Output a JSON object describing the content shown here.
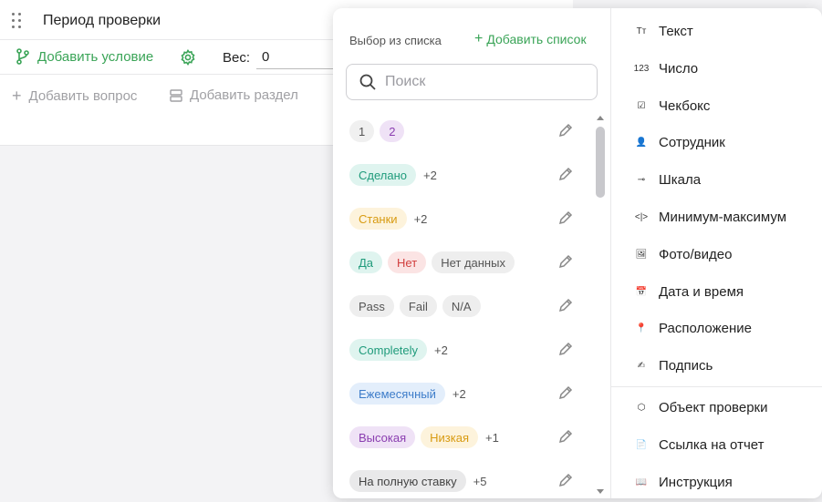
{
  "question": {
    "title": "Период проверки",
    "add_condition": "Добавить условие",
    "weight_label": "Вес:",
    "weight_value": "0",
    "add_question": "Добавить вопрос",
    "add_section": "Добавить раздел"
  },
  "dropdown": {
    "list_header": "Выбор из списка",
    "add_list": "Добавить список",
    "search_placeholder": "Поиск",
    "lists": [
      {
        "chips": [
          {
            "label": "1",
            "color": "#f0f0f0",
            "text": "#555"
          },
          {
            "label": "2",
            "color": "#efe2f6",
            "text": "#8a3db0"
          }
        ],
        "more": ""
      },
      {
        "chips": [
          {
            "label": "Сделано",
            "color": "#dff4ef",
            "text": "#1f9b7b"
          }
        ],
        "more": "+2"
      },
      {
        "chips": [
          {
            "label": "Станки",
            "color": "#fdf3dc",
            "text": "#d89b12"
          }
        ],
        "more": "+2"
      },
      {
        "chips": [
          {
            "label": "Да",
            "color": "#dff4ef",
            "text": "#1f9b7b"
          },
          {
            "label": "Нет",
            "color": "#fbe4e4",
            "text": "#d2403f"
          },
          {
            "label": "Нет данных",
            "color": "#eeeeee",
            "text": "#555"
          }
        ],
        "more": ""
      },
      {
        "chips": [
          {
            "label": "Pass",
            "color": "#eeeeee",
            "text": "#555"
          },
          {
            "label": "Fail",
            "color": "#eeeeee",
            "text": "#555"
          },
          {
            "label": "N/A",
            "color": "#eeeeee",
            "text": "#555"
          }
        ],
        "more": ""
      },
      {
        "chips": [
          {
            "label": "Completely",
            "color": "#dff4ef",
            "text": "#1f9b7b"
          }
        ],
        "more": "+2"
      },
      {
        "chips": [
          {
            "label": "Ежемесячный",
            "color": "#e3eefb",
            "text": "#3d7cc9"
          }
        ],
        "more": "+2"
      },
      {
        "chips": [
          {
            "label": "Высокая",
            "color": "#efe2f6",
            "text": "#8a3db0"
          },
          {
            "label": "Низкая",
            "color": "#fdf3dc",
            "text": "#d89b12"
          }
        ],
        "more": "+1"
      },
      {
        "chips": [
          {
            "label": "На полную ставку",
            "color": "#e9e9ea",
            "text": "#444"
          }
        ],
        "more": "+5"
      }
    ],
    "types": [
      {
        "icon": "text-icon",
        "glyph": "Tт",
        "label": "Текст"
      },
      {
        "icon": "number-icon",
        "glyph": "123",
        "label": "Число"
      },
      {
        "icon": "checkbox-icon",
        "glyph": "☑",
        "label": "Чекбокс"
      },
      {
        "icon": "person-icon",
        "glyph": "👤",
        "label": "Сотрудник"
      },
      {
        "icon": "scale-icon",
        "glyph": "⊸",
        "label": "Шкала"
      },
      {
        "icon": "min-max-icon",
        "glyph": "<|>",
        "label": "Минимум-максимум"
      },
      {
        "icon": "image-icon",
        "glyph": "🖼",
        "label": "Фото/видео"
      },
      {
        "icon": "calendar-icon",
        "glyph": "📅",
        "label": "Дата и время"
      },
      {
        "icon": "location-icon",
        "glyph": "📍",
        "label": "Расположение"
      },
      {
        "icon": "signature-icon",
        "glyph": "✍",
        "label": "Подпись"
      },
      {
        "icon": "cube-icon",
        "glyph": "⬡",
        "label": "Объект проверки"
      },
      {
        "icon": "file-icon",
        "glyph": "📄",
        "label": "Ссылка на отчет"
      },
      {
        "icon": "book-icon",
        "glyph": "📖",
        "label": "Инструкция"
      }
    ]
  },
  "colors": {
    "accent": "#3aa457"
  }
}
